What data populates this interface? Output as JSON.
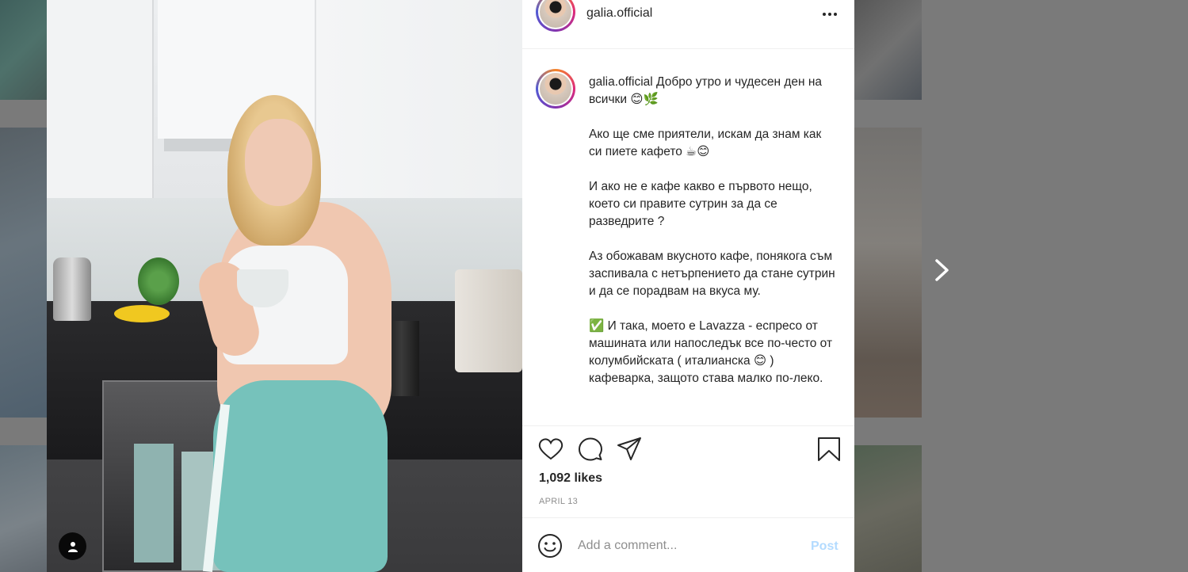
{
  "post": {
    "username": "galia.official",
    "caption": "Добро утро и чудесен ден на всички 😊🌿\n\nАко ще сме приятели, искам да знам как си пиете кафето ☕😊\n\nИ ако не е кафе какво е първото нещо, което си правите сутрин за да се разведрите ?\n\nАз обожавам вкусното кафе, понякога съм заспивала с нетърпението да стане сутрин и да се порадвам на вкуса му.\n\n✅ И така, моето е Lavazza - еспресо от машината или напоследък все по-често от колумбийската ( италианска 😊 ) кафеварка, защото става малко по-леко.",
    "likes": "1,092 likes",
    "date": "APRIL 13"
  },
  "comment": {
    "placeholder": "Add a comment...",
    "post_label": "Post"
  },
  "icons": {
    "more": "more-options-icon",
    "like": "heart-icon",
    "comment": "comment-icon",
    "share": "share-icon",
    "save": "bookmark-icon",
    "emoji": "emoji-icon",
    "next": "chevron-right-icon",
    "user_tag": "user-tag-icon"
  },
  "colors": {
    "post_button_disabled": "#b3dbff",
    "secondary_text": "#8e8e8e",
    "primary_text": "#262626"
  }
}
